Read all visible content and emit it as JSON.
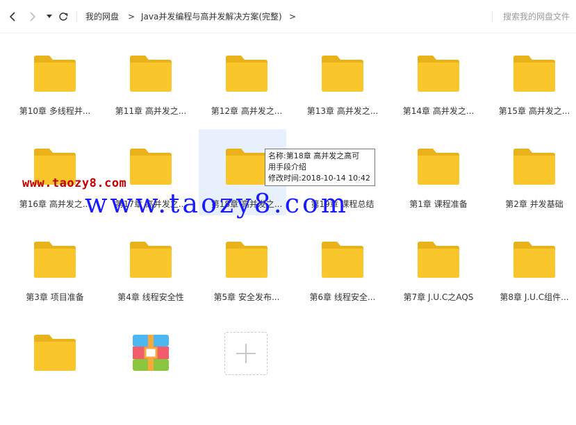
{
  "toolbar": {
    "breadcrumb": [
      "我的网盘",
      "Java并发编程与高并发解决方案(完整)"
    ],
    "separator": ">",
    "search_placeholder": "搜索我的网盘文件"
  },
  "folders": [
    {
      "name": "第10章 多线程并..."
    },
    {
      "name": "第11章 高并发之..."
    },
    {
      "name": "第12章 高并发之..."
    },
    {
      "name": "第13章 高并发之..."
    },
    {
      "name": "第14章 高并发之..."
    },
    {
      "name": "第15章 高并发之..."
    },
    {
      "name": "第16章 高并发之..."
    },
    {
      "name": "第17章 高并发之..."
    },
    {
      "name": "第18章 高并发之..."
    },
    {
      "name": "第19章 课程总结"
    },
    {
      "name": "第1章 课程准备"
    },
    {
      "name": "第2章 并发基础"
    },
    {
      "name": "第3章 项目准备"
    },
    {
      "name": "第4章 线程安全性"
    },
    {
      "name": "第5章 安全发布..."
    },
    {
      "name": "第6章 线程安全..."
    },
    {
      "name": "第7章 J.U.C之AQS"
    },
    {
      "name": "第8章 J.U.C组件..."
    },
    {
      "name": ""
    }
  ],
  "tooltip": {
    "line1": "名称:第18章 高并发之高可",
    "line2": "用手段介绍",
    "line3": "修改时间:2018-10-14 10:42"
  },
  "watermark": {
    "small": "www.taozy8.com",
    "big": "www.taozy8.com"
  },
  "colors": {
    "folder": "#f9c62b",
    "folder_tab": "#e9b21b",
    "hover": "#e9f0fd"
  }
}
